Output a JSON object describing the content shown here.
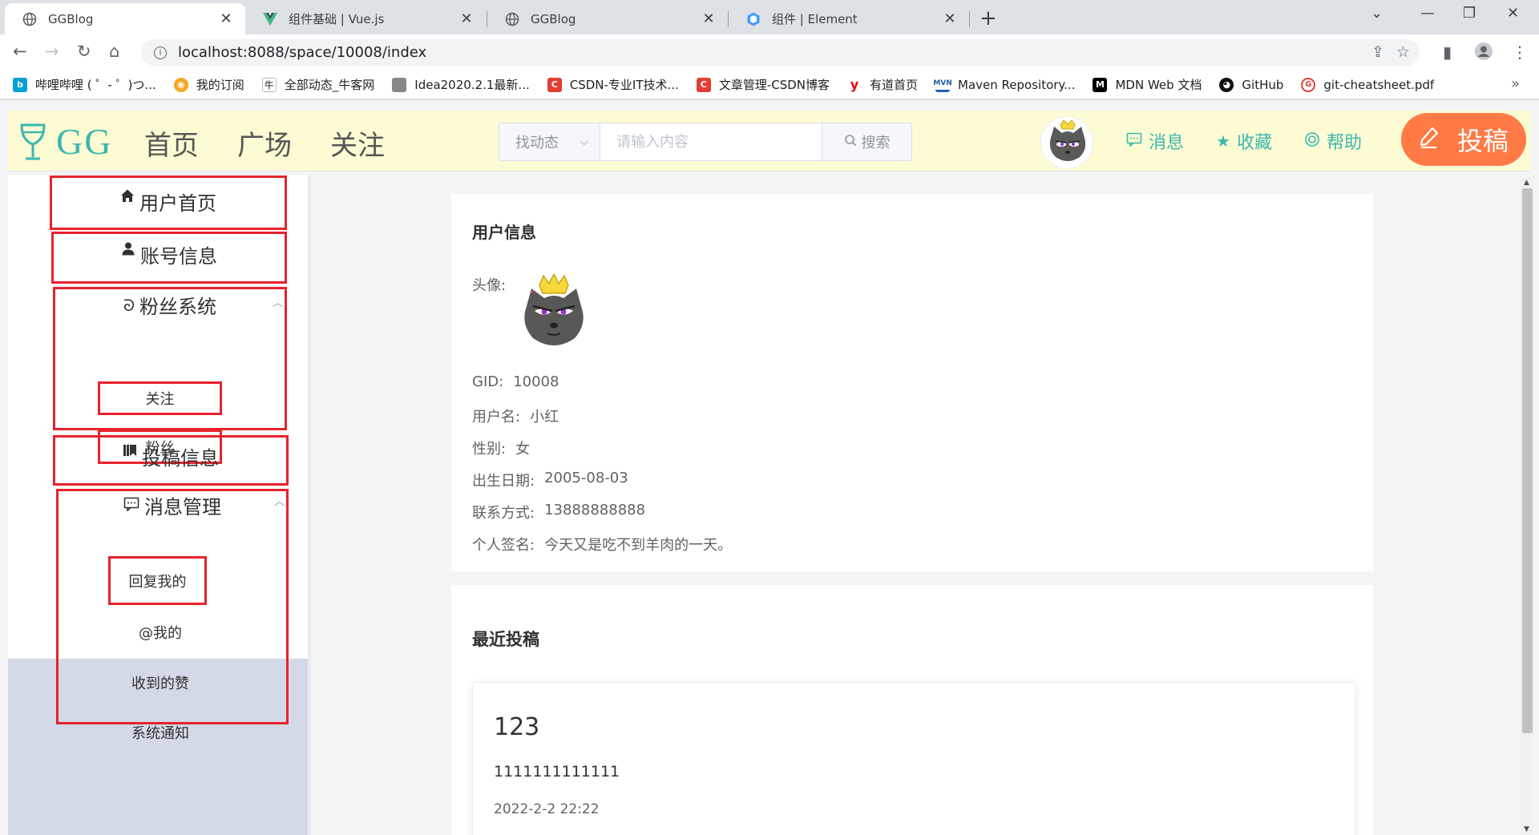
{
  "browser": {
    "tabs": [
      {
        "title": "GGBlog",
        "active": true,
        "icon": "globe-icon"
      },
      {
        "title": "组件基础 | Vue.js",
        "active": false,
        "icon": "vue-icon"
      },
      {
        "title": "GGBlog",
        "active": false,
        "icon": "globe-icon"
      },
      {
        "title": "组件 | Element",
        "active": false,
        "icon": "element-icon"
      }
    ],
    "close_glyph": "✕",
    "new_tab_glyph": "+",
    "url": "localhost:8088/space/10008/index",
    "bookmarks": [
      {
        "label": "哔哩哔哩 ( ゜- ゜)つ...",
        "icon": "bilibili-icon",
        "color": "#00a1d6"
      },
      {
        "label": "我的订阅",
        "icon": "rss-icon",
        "color": "#f5a623"
      },
      {
        "label": "全部动态_牛客网",
        "icon": "nowcoder-icon",
        "color": "#555555"
      },
      {
        "label": "Idea2020.2.1最新...",
        "icon": "image-icon",
        "color": "#888888"
      },
      {
        "label": "CSDN-专业IT技术...",
        "icon": "csdn-icon",
        "color": "#e33e33"
      },
      {
        "label": "文章管理-CSDN博客",
        "icon": "csdn-icon",
        "color": "#e33e33"
      },
      {
        "label": "有道首页",
        "icon": "youdao-icon",
        "color": "#e60012"
      },
      {
        "label": "Maven Repository...",
        "icon": "maven-icon",
        "color": "#1f5ea8"
      },
      {
        "label": "MDN Web 文档",
        "icon": "mdn-icon",
        "color": "#000000"
      },
      {
        "label": "GitHub",
        "icon": "github-icon",
        "color": "#111111"
      },
      {
        "label": "git-cheatsheet.pdf",
        "icon": "git-icon",
        "color": "#e33e33"
      }
    ],
    "bookmarks_more": "»"
  },
  "header": {
    "brand": "GG",
    "nav": [
      "首页",
      "广场",
      "关注"
    ],
    "search_select": "找动态",
    "search_placeholder": "请输入内容",
    "search_button": "搜索",
    "links": [
      {
        "label": "消息",
        "icon": "message-icon"
      },
      {
        "label": "收藏",
        "icon": "star-icon"
      },
      {
        "label": "帮助",
        "icon": "help-icon"
      }
    ],
    "submit_label": "投稿",
    "accent_color": "#3ab7b0",
    "submit_color": "#ff7a45"
  },
  "sidebar": {
    "home": "用户首页",
    "account": "账号信息",
    "fans_group": "粉丝系统",
    "fans_items": [
      "关注",
      "粉丝"
    ],
    "posts": "投稿信息",
    "messages_group": "消息管理",
    "message_items": [
      "回复我的",
      "@我的",
      "收到的赞",
      "系统通知"
    ],
    "highlight_color": "#e8222d"
  },
  "user_info": {
    "title": "用户信息",
    "avatar_label": "头像:",
    "rows": [
      {
        "key": "GID:",
        "value": "10008"
      },
      {
        "key": "用户名:",
        "value": "小红"
      },
      {
        "key": "性别:",
        "value": "女"
      },
      {
        "key": "出生日期:",
        "value": "2005-08-03"
      },
      {
        "key": "联系方式:",
        "value": "13888888888"
      },
      {
        "key": "个人签名:",
        "value": "今天又是吃不到羊肉的一天。"
      }
    ]
  },
  "recent_posts": {
    "title": "最近投稿",
    "posts": [
      {
        "title": "123",
        "body": "1111111111111",
        "time": "2022-2-2 22:22"
      }
    ]
  }
}
